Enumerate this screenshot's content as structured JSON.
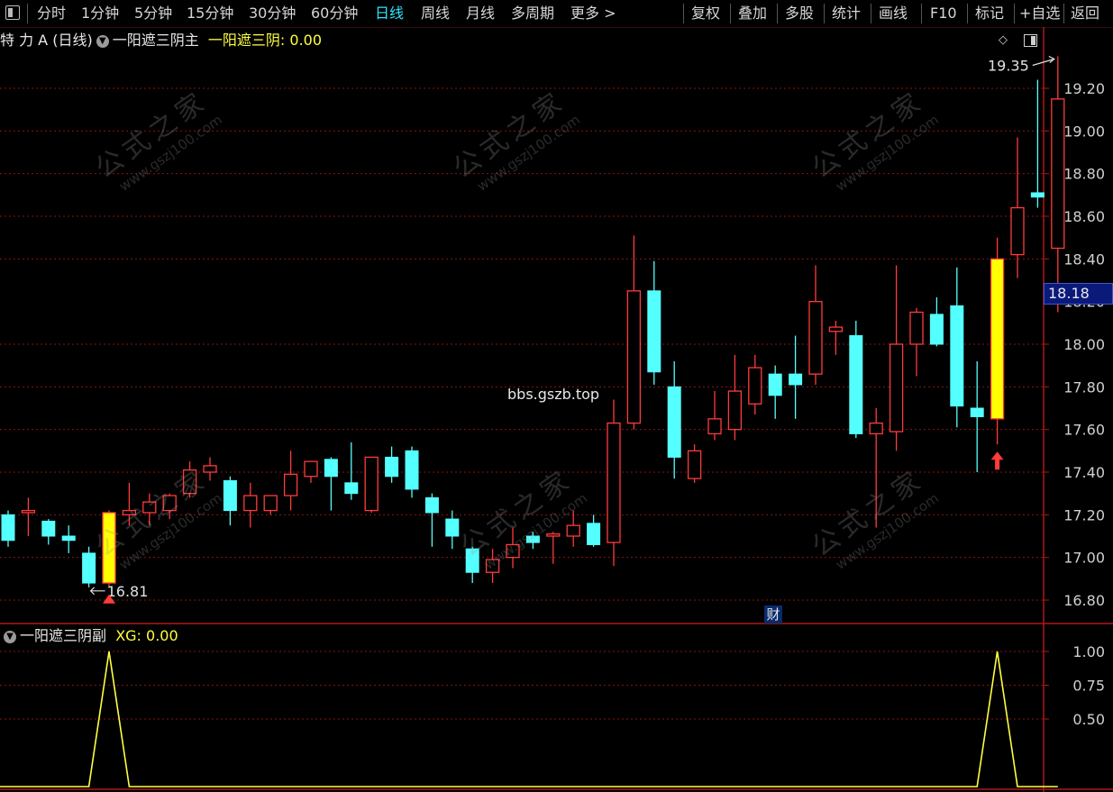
{
  "toolbar": {
    "periods": [
      "分时",
      "1分钟",
      "5分钟",
      "15分钟",
      "30分钟",
      "60分钟",
      "日线",
      "周线",
      "月线",
      "多周期",
      "更多 >"
    ],
    "active_period": "日线",
    "tools": [
      "复权",
      "叠加",
      "多股",
      "统计",
      "画线",
      "F10",
      "标记",
      "+自选",
      "返回"
    ]
  },
  "main_header": {
    "stock": "特 力 A (日线)",
    "indicator": "一阳遮三阴主",
    "output_label": "一阳遮三阴:",
    "output_value": "0.00"
  },
  "sub_header": {
    "indicator": "一阳遮三阴副",
    "output_label": "XG:",
    "output_value": "0.00"
  },
  "overlay": {
    "site_text": "bbs.gszb.top",
    "fin_badge": "财",
    "watermark_title": "公式之家",
    "watermark_url": "www.gszj100.com"
  },
  "colors": {
    "up": "#ff3b3b",
    "down": "#54ffff",
    "signal": "#ffff00",
    "grid": "#8a1414",
    "axis_text": "#d0d0d0",
    "line": "#ffff40"
  },
  "chart_data": [
    {
      "type": "candlestick",
      "title": "",
      "ylim": [
        16.7,
        19.4
      ],
      "yticks": [
        16.8,
        17.0,
        17.2,
        17.4,
        17.6,
        17.8,
        18.0,
        18.2,
        18.4,
        18.6,
        18.8,
        19.0,
        19.2
      ],
      "last_price": "18.18",
      "max_label": "19.35",
      "min_label": "16.81",
      "series": [
        {
          "o": 17.2,
          "h": 17.22,
          "l": 17.05,
          "c": 17.08
        },
        {
          "o": 17.21,
          "h": 17.28,
          "l": 17.1,
          "c": 17.22
        },
        {
          "o": 17.17,
          "h": 17.18,
          "l": 17.06,
          "c": 17.1
        },
        {
          "o": 17.1,
          "h": 17.15,
          "l": 17.02,
          "c": 17.08
        },
        {
          "o": 17.02,
          "h": 17.05,
          "l": 16.86,
          "c": 16.88
        },
        {
          "o": 16.88,
          "h": 17.22,
          "l": 16.86,
          "c": 17.21
        },
        {
          "o": 17.2,
          "h": 17.35,
          "l": 17.15,
          "c": 17.22
        },
        {
          "o": 17.21,
          "h": 17.3,
          "l": 17.15,
          "c": 17.26
        },
        {
          "o": 17.22,
          "h": 17.3,
          "l": 17.18,
          "c": 17.29
        },
        {
          "o": 17.3,
          "h": 17.45,
          "l": 17.28,
          "c": 17.41
        },
        {
          "o": 17.4,
          "h": 17.47,
          "l": 17.36,
          "c": 17.43
        },
        {
          "o": 17.36,
          "h": 17.38,
          "l": 17.15,
          "c": 17.22
        },
        {
          "o": 17.22,
          "h": 17.35,
          "l": 17.14,
          "c": 17.29
        },
        {
          "o": 17.22,
          "h": 17.29,
          "l": 17.2,
          "c": 17.29
        },
        {
          "o": 17.29,
          "h": 17.5,
          "l": 17.22,
          "c": 17.39
        },
        {
          "o": 17.38,
          "h": 17.45,
          "l": 17.35,
          "c": 17.45
        },
        {
          "o": 17.46,
          "h": 17.47,
          "l": 17.22,
          "c": 17.38
        },
        {
          "o": 17.35,
          "h": 17.54,
          "l": 17.27,
          "c": 17.3
        },
        {
          "o": 17.22,
          "h": 17.47,
          "l": 17.21,
          "c": 17.47
        },
        {
          "o": 17.47,
          "h": 17.52,
          "l": 17.35,
          "c": 17.38
        },
        {
          "o": 17.5,
          "h": 17.52,
          "l": 17.28,
          "c": 17.32
        },
        {
          "o": 17.28,
          "h": 17.3,
          "l": 17.05,
          "c": 17.21
        },
        {
          "o": 17.18,
          "h": 17.22,
          "l": 17.04,
          "c": 17.1
        },
        {
          "o": 17.04,
          "h": 17.05,
          "l": 16.88,
          "c": 16.93
        },
        {
          "o": 16.93,
          "h": 17.04,
          "l": 16.88,
          "c": 16.99
        },
        {
          "o": 17.0,
          "h": 17.14,
          "l": 16.95,
          "c": 17.06
        },
        {
          "o": 17.1,
          "h": 17.12,
          "l": 17.04,
          "c": 17.07
        },
        {
          "o": 17.1,
          "h": 17.12,
          "l": 16.97,
          "c": 17.11
        },
        {
          "o": 17.1,
          "h": 17.22,
          "l": 17.05,
          "c": 17.15
        },
        {
          "o": 17.16,
          "h": 17.2,
          "l": 17.05,
          "c": 17.06
        },
        {
          "o": 17.07,
          "h": 17.74,
          "l": 16.96,
          "c": 17.63
        },
        {
          "o": 17.63,
          "h": 18.51,
          "l": 17.6,
          "c": 18.25
        },
        {
          "o": 18.25,
          "h": 18.39,
          "l": 17.81,
          "c": 17.87
        },
        {
          "o": 17.8,
          "h": 17.92,
          "l": 17.37,
          "c": 17.47
        },
        {
          "o": 17.37,
          "h": 17.53,
          "l": 17.35,
          "c": 17.5
        },
        {
          "o": 17.58,
          "h": 17.78,
          "l": 17.55,
          "c": 17.65
        },
        {
          "o": 17.6,
          "h": 17.95,
          "l": 17.55,
          "c": 17.78
        },
        {
          "o": 17.72,
          "h": 17.95,
          "l": 17.67,
          "c": 17.89
        },
        {
          "o": 17.86,
          "h": 17.9,
          "l": 17.65,
          "c": 17.76
        },
        {
          "o": 17.86,
          "h": 18.04,
          "l": 17.65,
          "c": 17.81
        },
        {
          "o": 17.86,
          "h": 18.37,
          "l": 17.81,
          "c": 18.2
        },
        {
          "o": 18.06,
          "h": 18.11,
          "l": 17.95,
          "c": 18.08
        },
        {
          "o": 18.04,
          "h": 18.11,
          "l": 17.56,
          "c": 17.58
        },
        {
          "o": 17.58,
          "h": 17.7,
          "l": 17.14,
          "c": 17.63
        },
        {
          "o": 17.59,
          "h": 18.37,
          "l": 17.5,
          "c": 18.0
        },
        {
          "o": 18.0,
          "h": 18.17,
          "l": 17.85,
          "c": 18.15
        },
        {
          "o": 18.14,
          "h": 18.22,
          "l": 17.99,
          "c": 18.0
        },
        {
          "o": 18.18,
          "h": 18.36,
          "l": 17.61,
          "c": 17.71
        },
        {
          "o": 17.7,
          "h": 17.92,
          "l": 17.4,
          "c": 17.66
        },
        {
          "o": 17.65,
          "h": 18.5,
          "l": 17.53,
          "c": 18.4
        },
        {
          "o": 18.42,
          "h": 18.97,
          "l": 18.31,
          "c": 18.64
        },
        {
          "o": 18.71,
          "h": 19.24,
          "l": 18.64,
          "c": 18.69
        },
        {
          "o": 18.45,
          "h": 19.35,
          "l": 18.15,
          "c": 19.15
        }
      ],
      "signal_bars": [
        5,
        49
      ],
      "signal_arrow_bar": 49
    },
    {
      "type": "line",
      "title": "",
      "series_name": "XG",
      "ylim": [
        0,
        1.1
      ],
      "yticks": [
        0.5,
        0.75,
        1.0
      ],
      "values": [
        0,
        0,
        0,
        0,
        0,
        1,
        0,
        0,
        0,
        0,
        0,
        0,
        0,
        0,
        0,
        0,
        0,
        0,
        0,
        0,
        0,
        0,
        0,
        0,
        0,
        0,
        0,
        0,
        0,
        0,
        0,
        0,
        0,
        0,
        0,
        0,
        0,
        0,
        0,
        0,
        0,
        0,
        0,
        0,
        0,
        0,
        0,
        0,
        0,
        1,
        0,
        0,
        0
      ]
    }
  ]
}
